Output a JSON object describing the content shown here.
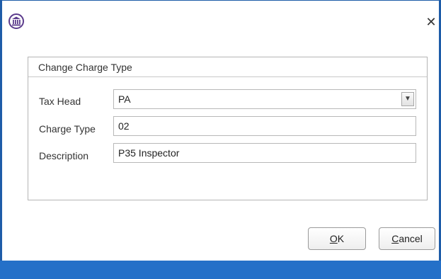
{
  "dialog": {
    "close_glyph": "✕",
    "icon": "courthouse-icon"
  },
  "group": {
    "title": "Change Charge Type"
  },
  "form": {
    "tax_head": {
      "label": "Tax Head",
      "value": "PA",
      "arrow": "▼"
    },
    "charge_type": {
      "label": "Charge Type",
      "value": "02"
    },
    "description": {
      "label": "Description",
      "value": "P35 Inspector"
    }
  },
  "buttons": {
    "ok_mnemonic": "O",
    "ok_rest": "K",
    "cancel_mnemonic": "C",
    "cancel_rest": "ancel"
  },
  "colors": {
    "frame": "#1e5ca8",
    "footer": "#2470c8",
    "icon": "#5b3b8c"
  }
}
